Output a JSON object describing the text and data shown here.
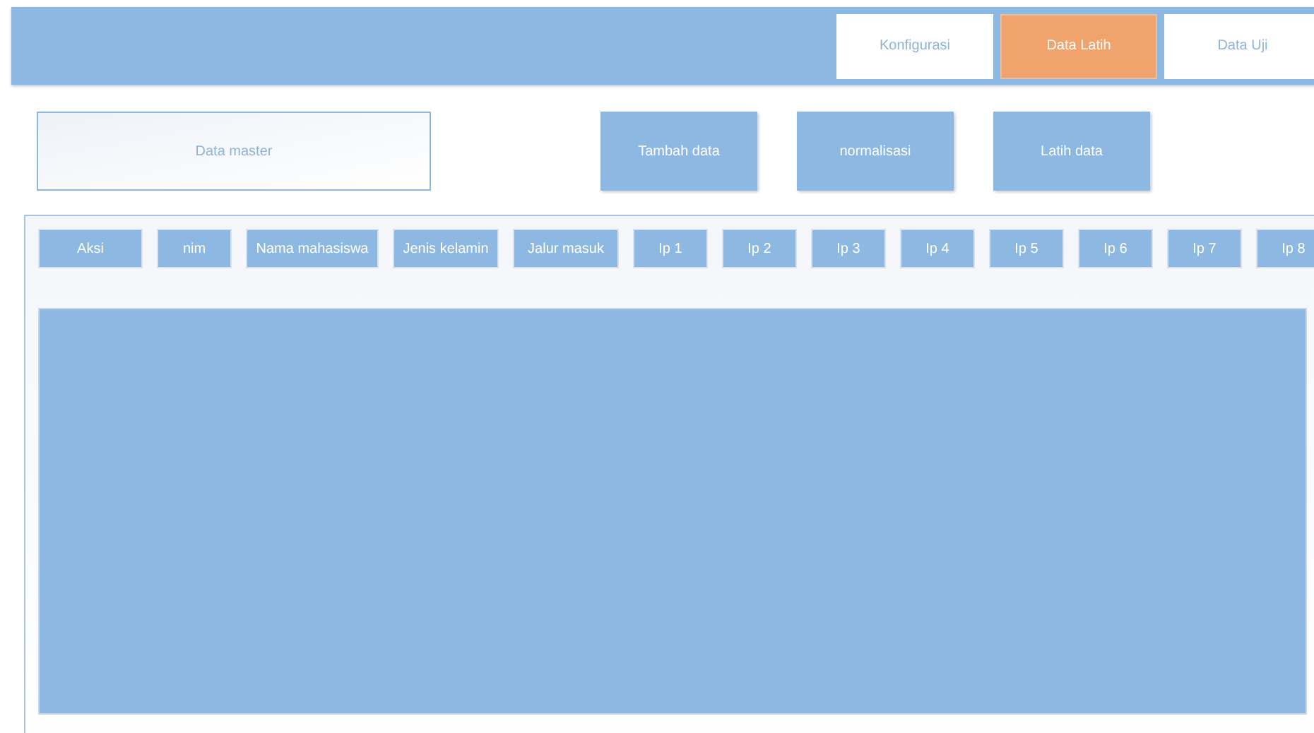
{
  "tabs": [
    {
      "label": "Konfigurasi",
      "selected": false
    },
    {
      "label": "Data Latih",
      "selected": true
    },
    {
      "label": "Data Uji",
      "selected": false
    }
  ],
  "data_master": {
    "label": "Data master"
  },
  "buttons": [
    "Tambah data",
    "normalisasi",
    "Latih data"
  ],
  "table": {
    "columns": [
      "Aksi",
      "nim",
      "Nama mahasiswa",
      "Jenis kelamin",
      "Jalur masuk",
      "Ip 1",
      "Ip 2",
      "Ip 3",
      "Ip 4",
      "Ip 5",
      "Ip 6",
      "Ip 7",
      "Ip 8"
    ]
  }
}
